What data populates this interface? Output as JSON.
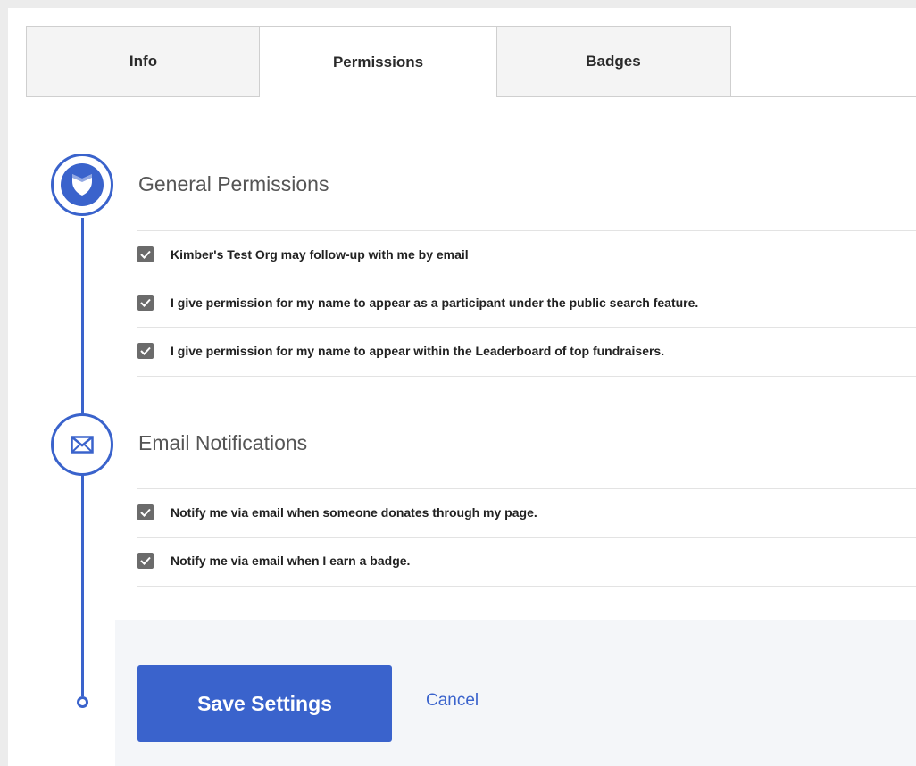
{
  "tabs": [
    {
      "label": "Info",
      "active": false
    },
    {
      "label": "Permissions",
      "active": true
    },
    {
      "label": "Badges",
      "active": false
    }
  ],
  "sections": {
    "general": {
      "title": "General Permissions",
      "icon": "shield-icon",
      "items": [
        {
          "label": "Kimber's Test Org may follow-up with me by email",
          "checked": true
        },
        {
          "label": "I give permission for my name to appear as a participant under the public search feature.",
          "checked": true
        },
        {
          "label": "I give permission for my name to appear within the Leaderboard of top fundraisers.",
          "checked": true
        }
      ]
    },
    "email": {
      "title": "Email Notifications",
      "icon": "envelope-icon",
      "items": [
        {
          "label": "Notify me via email when someone donates through my page.",
          "checked": true
        },
        {
          "label": "Notify me via email when I earn a badge.",
          "checked": true
        }
      ]
    }
  },
  "actions": {
    "save_label": "Save Settings",
    "cancel_label": "Cancel"
  },
  "colors": {
    "accent": "#3a63cc",
    "checkbox": "#6b6b6b",
    "footer_background": "#f4f6f9"
  }
}
